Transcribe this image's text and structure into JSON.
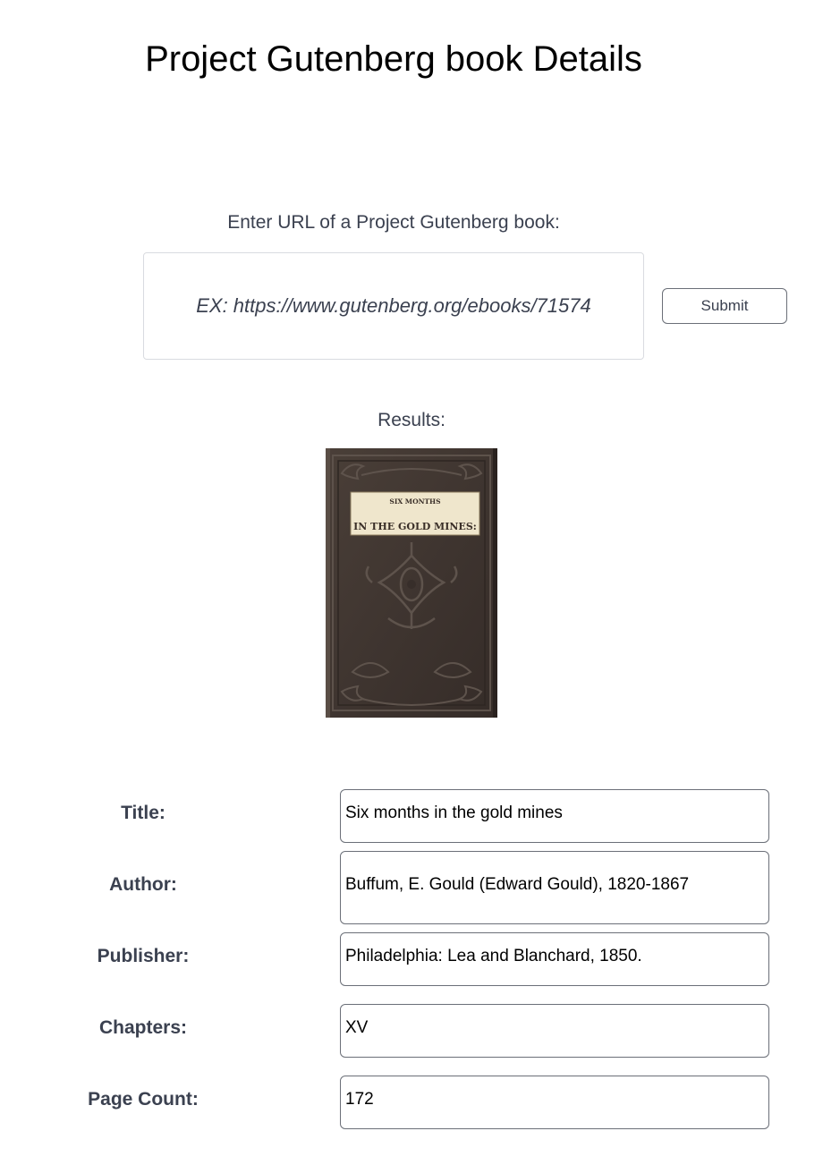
{
  "page": {
    "title": "Project Gutenberg book Details"
  },
  "search": {
    "label": "Enter URL of a Project Gutenberg book:",
    "placeholder": "EX: https://www.gutenberg.org/ebooks/71574",
    "value": "",
    "submit_label": "Submit"
  },
  "results": {
    "label": "Results:",
    "cover": {
      "line1": "SIX MONTHS",
      "line2": "IN THE GOLD MINES:"
    }
  },
  "fields": {
    "title": {
      "label": "Title:",
      "value": "Six months in the gold mines"
    },
    "author": {
      "label": "Author:",
      "value": "Buffum, E. Gould (Edward Gould), 1820-1867"
    },
    "publisher": {
      "label": "Publisher:",
      "value": "Philadelphia: Lea and Blanchard, 1850."
    },
    "chapters": {
      "label": "Chapters:",
      "value": "XV"
    },
    "page_count": {
      "label": "Page Count:",
      "value": "172"
    }
  }
}
